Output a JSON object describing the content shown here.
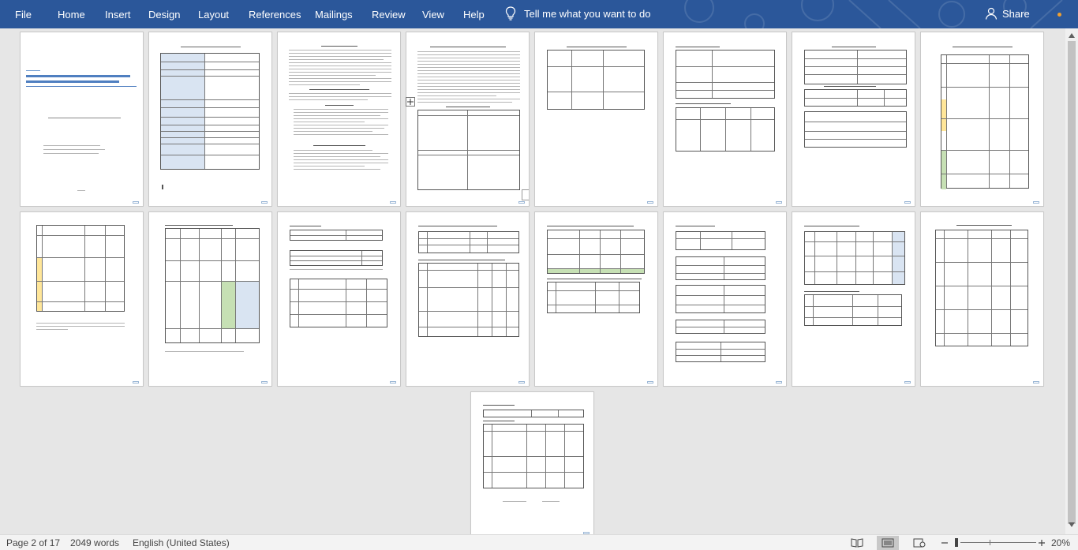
{
  "ribbon": {
    "tabs": [
      {
        "id": "file",
        "label": "File"
      },
      {
        "id": "home",
        "label": "Home"
      },
      {
        "id": "insert",
        "label": "Insert"
      },
      {
        "id": "design",
        "label": "Design"
      },
      {
        "id": "layout",
        "label": "Layout"
      },
      {
        "id": "references",
        "label": "References"
      },
      {
        "id": "mailings",
        "label": "Mailings"
      },
      {
        "id": "review",
        "label": "Review"
      },
      {
        "id": "view",
        "label": "View"
      },
      {
        "id": "help",
        "label": "Help"
      }
    ],
    "tell_me": "Tell me what you want to do",
    "share": "Share"
  },
  "status_bar": {
    "page": "Page 2 of 17",
    "words": "2049 words",
    "language": "English (United States)",
    "zoom": "20%"
  },
  "colors": {
    "ribbon": "#2b579a",
    "canvas": "#e6e6e6",
    "status_bar": "#f3f3f3"
  }
}
